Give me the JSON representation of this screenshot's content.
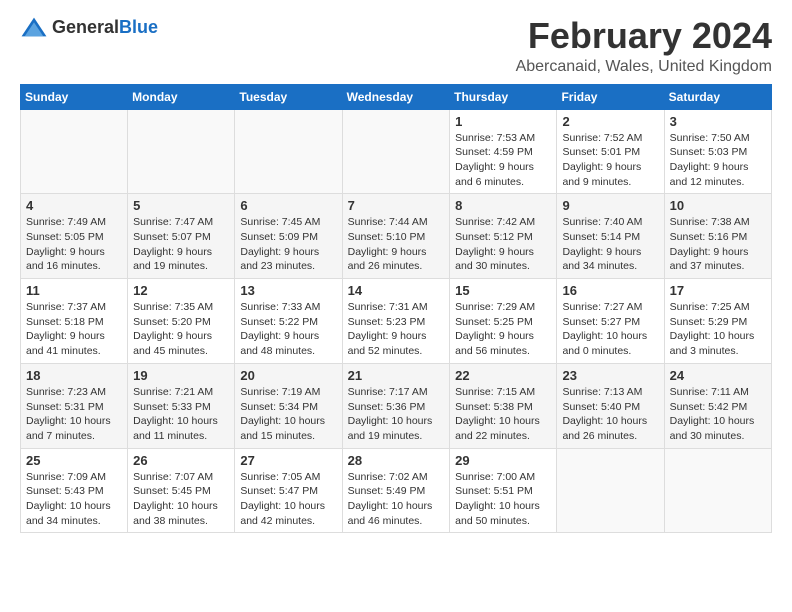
{
  "header": {
    "logo_general": "General",
    "logo_blue": "Blue",
    "month": "February 2024",
    "location": "Abercanaid, Wales, United Kingdom"
  },
  "weekdays": [
    "Sunday",
    "Monday",
    "Tuesday",
    "Wednesday",
    "Thursday",
    "Friday",
    "Saturday"
  ],
  "weeks": [
    [
      {
        "day": "",
        "info": ""
      },
      {
        "day": "",
        "info": ""
      },
      {
        "day": "",
        "info": ""
      },
      {
        "day": "",
        "info": ""
      },
      {
        "day": "1",
        "info": "Sunrise: 7:53 AM\nSunset: 4:59 PM\nDaylight: 9 hours\nand 6 minutes."
      },
      {
        "day": "2",
        "info": "Sunrise: 7:52 AM\nSunset: 5:01 PM\nDaylight: 9 hours\nand 9 minutes."
      },
      {
        "day": "3",
        "info": "Sunrise: 7:50 AM\nSunset: 5:03 PM\nDaylight: 9 hours\nand 12 minutes."
      }
    ],
    [
      {
        "day": "4",
        "info": "Sunrise: 7:49 AM\nSunset: 5:05 PM\nDaylight: 9 hours\nand 16 minutes."
      },
      {
        "day": "5",
        "info": "Sunrise: 7:47 AM\nSunset: 5:07 PM\nDaylight: 9 hours\nand 19 minutes."
      },
      {
        "day": "6",
        "info": "Sunrise: 7:45 AM\nSunset: 5:09 PM\nDaylight: 9 hours\nand 23 minutes."
      },
      {
        "day": "7",
        "info": "Sunrise: 7:44 AM\nSunset: 5:10 PM\nDaylight: 9 hours\nand 26 minutes."
      },
      {
        "day": "8",
        "info": "Sunrise: 7:42 AM\nSunset: 5:12 PM\nDaylight: 9 hours\nand 30 minutes."
      },
      {
        "day": "9",
        "info": "Sunrise: 7:40 AM\nSunset: 5:14 PM\nDaylight: 9 hours\nand 34 minutes."
      },
      {
        "day": "10",
        "info": "Sunrise: 7:38 AM\nSunset: 5:16 PM\nDaylight: 9 hours\nand 37 minutes."
      }
    ],
    [
      {
        "day": "11",
        "info": "Sunrise: 7:37 AM\nSunset: 5:18 PM\nDaylight: 9 hours\nand 41 minutes."
      },
      {
        "day": "12",
        "info": "Sunrise: 7:35 AM\nSunset: 5:20 PM\nDaylight: 9 hours\nand 45 minutes."
      },
      {
        "day": "13",
        "info": "Sunrise: 7:33 AM\nSunset: 5:22 PM\nDaylight: 9 hours\nand 48 minutes."
      },
      {
        "day": "14",
        "info": "Sunrise: 7:31 AM\nSunset: 5:23 PM\nDaylight: 9 hours\nand 52 minutes."
      },
      {
        "day": "15",
        "info": "Sunrise: 7:29 AM\nSunset: 5:25 PM\nDaylight: 9 hours\nand 56 minutes."
      },
      {
        "day": "16",
        "info": "Sunrise: 7:27 AM\nSunset: 5:27 PM\nDaylight: 10 hours\nand 0 minutes."
      },
      {
        "day": "17",
        "info": "Sunrise: 7:25 AM\nSunset: 5:29 PM\nDaylight: 10 hours\nand 3 minutes."
      }
    ],
    [
      {
        "day": "18",
        "info": "Sunrise: 7:23 AM\nSunset: 5:31 PM\nDaylight: 10 hours\nand 7 minutes."
      },
      {
        "day": "19",
        "info": "Sunrise: 7:21 AM\nSunset: 5:33 PM\nDaylight: 10 hours\nand 11 minutes."
      },
      {
        "day": "20",
        "info": "Sunrise: 7:19 AM\nSunset: 5:34 PM\nDaylight: 10 hours\nand 15 minutes."
      },
      {
        "day": "21",
        "info": "Sunrise: 7:17 AM\nSunset: 5:36 PM\nDaylight: 10 hours\nand 19 minutes."
      },
      {
        "day": "22",
        "info": "Sunrise: 7:15 AM\nSunset: 5:38 PM\nDaylight: 10 hours\nand 22 minutes."
      },
      {
        "day": "23",
        "info": "Sunrise: 7:13 AM\nSunset: 5:40 PM\nDaylight: 10 hours\nand 26 minutes."
      },
      {
        "day": "24",
        "info": "Sunrise: 7:11 AM\nSunset: 5:42 PM\nDaylight: 10 hours\nand 30 minutes."
      }
    ],
    [
      {
        "day": "25",
        "info": "Sunrise: 7:09 AM\nSunset: 5:43 PM\nDaylight: 10 hours\nand 34 minutes."
      },
      {
        "day": "26",
        "info": "Sunrise: 7:07 AM\nSunset: 5:45 PM\nDaylight: 10 hours\nand 38 minutes."
      },
      {
        "day": "27",
        "info": "Sunrise: 7:05 AM\nSunset: 5:47 PM\nDaylight: 10 hours\nand 42 minutes."
      },
      {
        "day": "28",
        "info": "Sunrise: 7:02 AM\nSunset: 5:49 PM\nDaylight: 10 hours\nand 46 minutes."
      },
      {
        "day": "29",
        "info": "Sunrise: 7:00 AM\nSunset: 5:51 PM\nDaylight: 10 hours\nand 50 minutes."
      },
      {
        "day": "",
        "info": ""
      },
      {
        "day": "",
        "info": ""
      }
    ]
  ]
}
